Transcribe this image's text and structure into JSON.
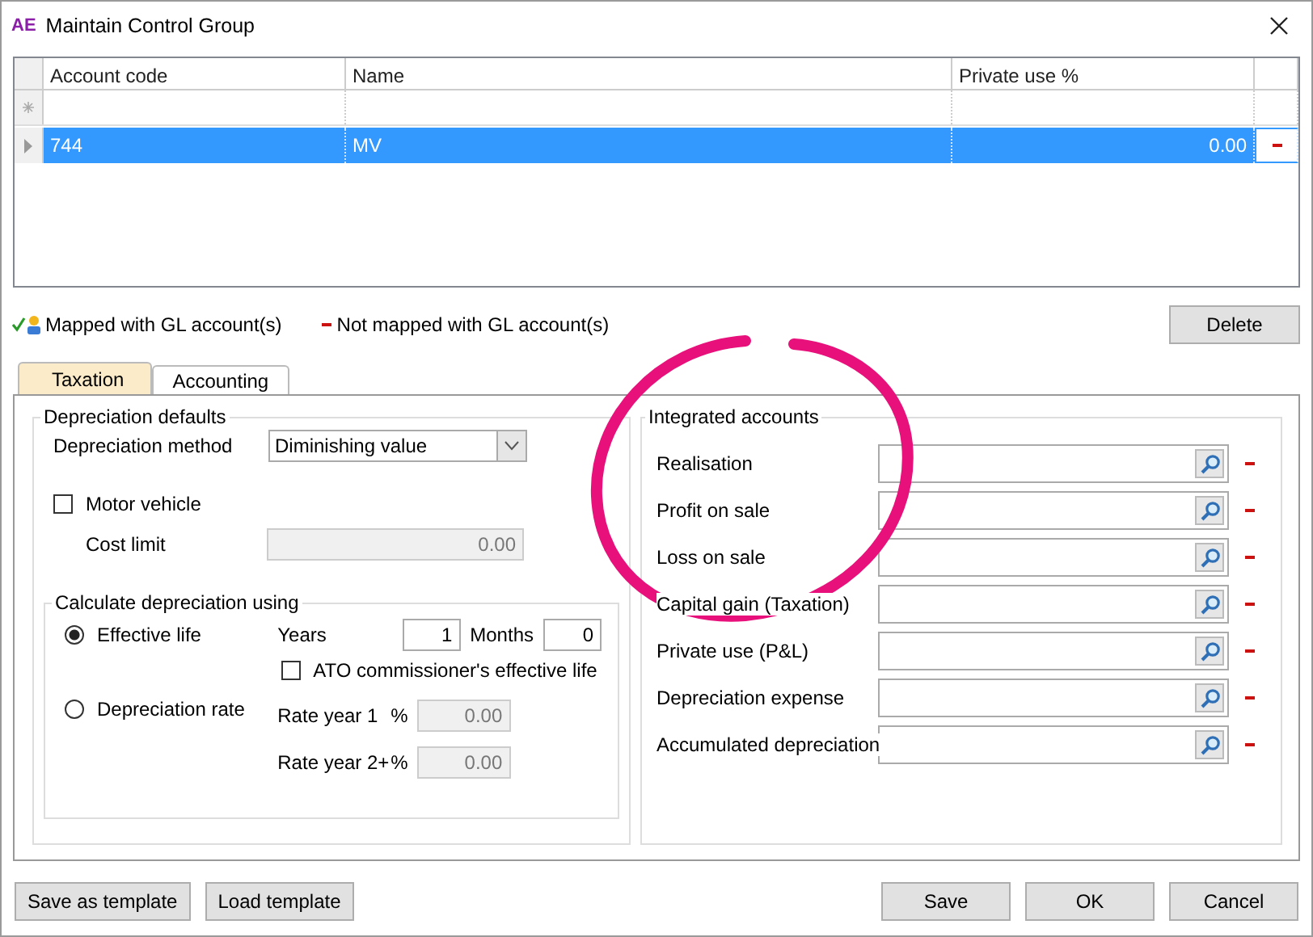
{
  "window": {
    "title": "Maintain Control Group",
    "logo": "AE"
  },
  "grid": {
    "columns": [
      "Account code",
      "Name",
      "Private use %"
    ],
    "rows": [
      {
        "account_code": "744",
        "name": "MV",
        "private_use": "0.00",
        "mapped": false,
        "selected": true
      }
    ]
  },
  "legend": [
    {
      "kind": "mapped",
      "label": "Mapped with GL account(s)"
    },
    {
      "kind": "not_mapped",
      "label": "Not mapped with GL account(s)"
    }
  ],
  "delete_button": "Delete",
  "tabs": [
    {
      "label": "Taxation",
      "selected": true
    },
    {
      "label": "Accounting",
      "selected": false
    }
  ],
  "depreciation_defaults": {
    "title": "Depreciation defaults",
    "method_label": "Depreciation method",
    "method_value": "Diminishing value",
    "motor_vehicle": {
      "label": "Motor vehicle",
      "checked": false
    },
    "cost_limit": {
      "label": "Cost limit",
      "value": "0.00",
      "disabled": true
    }
  },
  "calculate": {
    "title": "Calculate depreciation using",
    "options": [
      {
        "label": "Effective life",
        "selected": true
      },
      {
        "label": "Depreciation rate",
        "selected": false
      }
    ],
    "years_label": "Years",
    "years": "1",
    "months_label": "Months",
    "months": "0",
    "ato": {
      "label": "ATO commissioner's effective life",
      "checked": false
    },
    "rates": [
      {
        "label": "Rate year 1",
        "unit": "%",
        "value": "0.00",
        "disabled": true
      },
      {
        "label": "Rate year 2+",
        "unit": "%",
        "value": "0.00",
        "disabled": true
      }
    ]
  },
  "integrated": {
    "title": "Integrated accounts",
    "accounts": [
      {
        "label": "Realisation",
        "mapped": false
      },
      {
        "label": "Profit on sale",
        "mapped": false
      },
      {
        "label": "Loss on sale",
        "mapped": false
      },
      {
        "label": "Capital gain (Taxation)",
        "mapped": false
      },
      {
        "label": "Private use (P&L)",
        "mapped": false
      },
      {
        "label": "Depreciation expense",
        "mapped": false
      },
      {
        "label": "Accumulated depreciation",
        "mapped": false
      }
    ]
  },
  "footer_left": [
    "Save as template",
    "Load template"
  ],
  "footer_right": [
    "Save",
    "OK",
    "Cancel"
  ]
}
